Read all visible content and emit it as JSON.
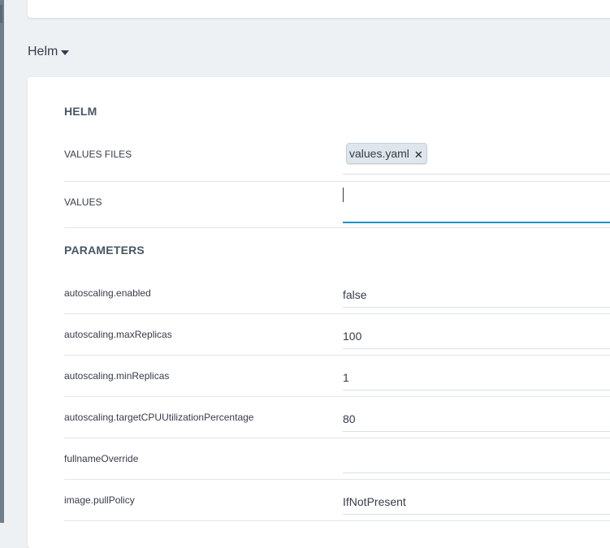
{
  "section_toggle": {
    "label": "Helm"
  },
  "helm": {
    "title": "HELM",
    "values_files_label": "VALUES FILES",
    "values_files": [
      "values.yaml"
    ],
    "values_label": "VALUES",
    "values_value": ""
  },
  "parameters": {
    "title": "PARAMETERS",
    "rows": [
      {
        "name": "autoscaling.enabled",
        "value": "false"
      },
      {
        "name": "autoscaling.maxReplicas",
        "value": "100"
      },
      {
        "name": "autoscaling.minReplicas",
        "value": "1"
      },
      {
        "name": "autoscaling.targetCPUUtilizationPercentage",
        "value": "80"
      },
      {
        "name": "fullnameOverride",
        "value": ""
      },
      {
        "name": "image.pullPolicy",
        "value": "IfNotPresent"
      }
    ]
  },
  "colors": {
    "background": "#eef1f4",
    "card": "#ffffff",
    "focus_underline": "#1d95c6",
    "tag_background": "#dee6eb"
  },
  "icons": {
    "dropdown": "caret-down-icon",
    "remove_tag": "close-icon"
  }
}
